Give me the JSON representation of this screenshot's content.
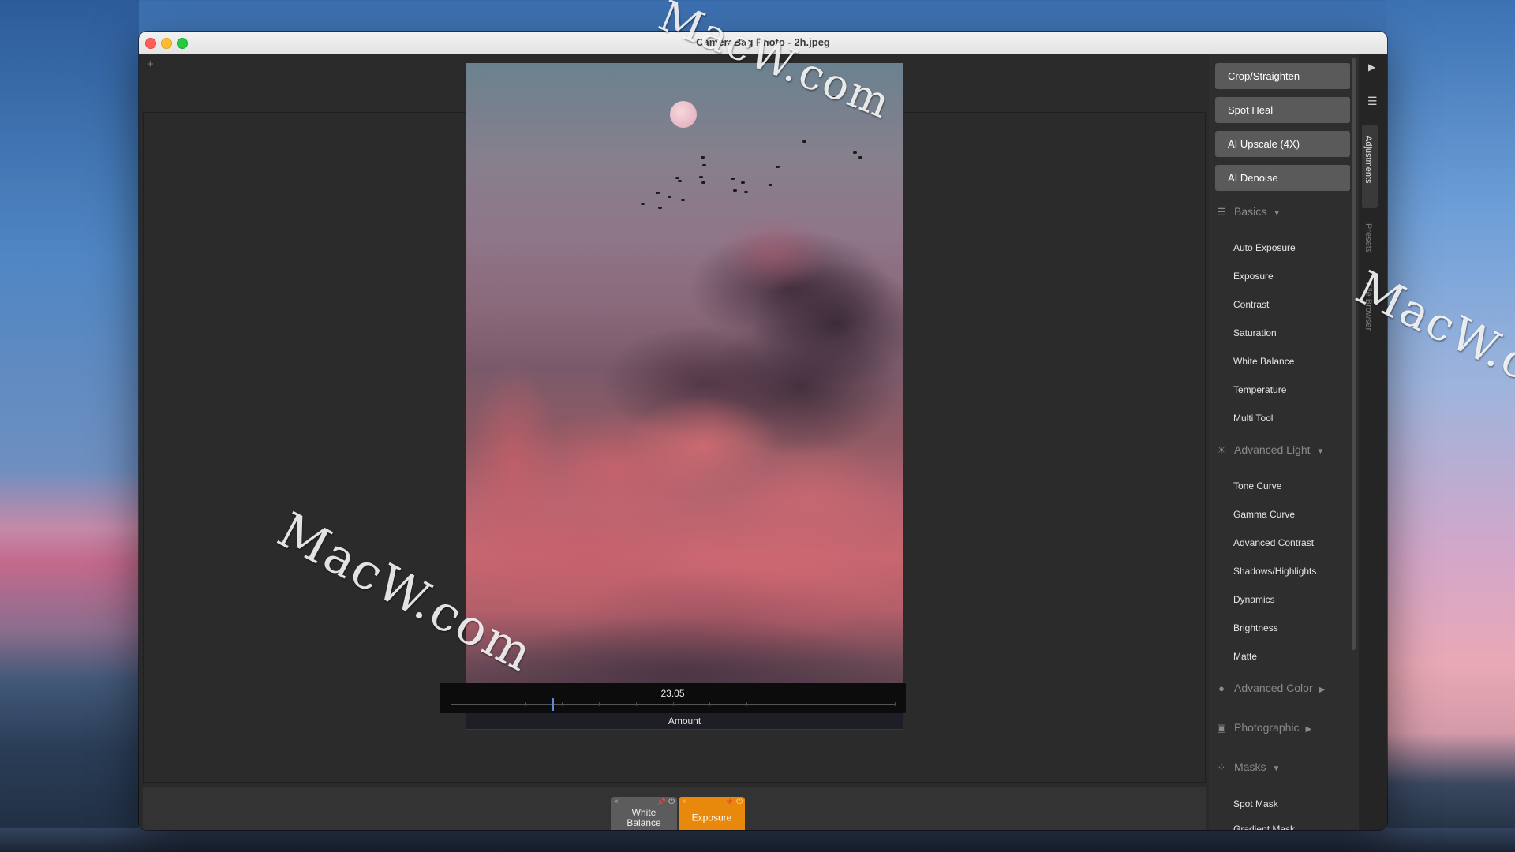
{
  "window": {
    "title": "CameraBag Photo - 2h.jpeg"
  },
  "editor": {
    "new_tab": "+",
    "slider": {
      "value": "23.05",
      "label": "Amount",
      "amount_fraction": 0.23
    }
  },
  "stack": {
    "chips": [
      {
        "label": "White Balance",
        "active": false
      },
      {
        "label": "Exposure",
        "active": true
      }
    ],
    "close_glyph": "×",
    "pin_glyph": "📌",
    "power_glyph": "⏻"
  },
  "bottom_tools": [
    "▼",
    "<",
    ">",
    "⏱",
    "✕"
  ],
  "sidebar": {
    "tools": [
      "Crop/Straighten",
      "Spot Heal",
      "AI Upscale (4X)",
      "AI Denoise"
    ],
    "sections": [
      {
        "title": "Basics",
        "icon": "sliders-icon",
        "expanded": true,
        "items": [
          "Auto Exposure",
          "Exposure",
          "Contrast",
          "Saturation",
          "White Balance",
          "Temperature",
          "Multi Tool"
        ]
      },
      {
        "title": "Advanced Light",
        "icon": "sun-icon",
        "expanded": true,
        "items": [
          "Tone Curve",
          "Gamma Curve",
          "Advanced Contrast",
          "Shadows/Highlights",
          "Dynamics",
          "Brightness",
          "Matte"
        ]
      },
      {
        "title": "Advanced Color",
        "icon": "color-drops-icon",
        "expanded": false,
        "items": []
      },
      {
        "title": "Photographic",
        "icon": "camera-icon",
        "expanded": false,
        "items": []
      },
      {
        "title": "Masks",
        "icon": "mask-icon",
        "expanded": true,
        "items": [
          "Spot Mask",
          "Gradient Mask"
        ]
      }
    ]
  },
  "tabs": {
    "items": [
      "Adjustments",
      "Presets",
      "File Browser"
    ],
    "active": "Adjustments"
  },
  "watermark": "MacW.com",
  "colors": {
    "accent": "#e8890c",
    "tool_button": "#5a5a5a",
    "slider_knob": "#5b8bd6"
  }
}
